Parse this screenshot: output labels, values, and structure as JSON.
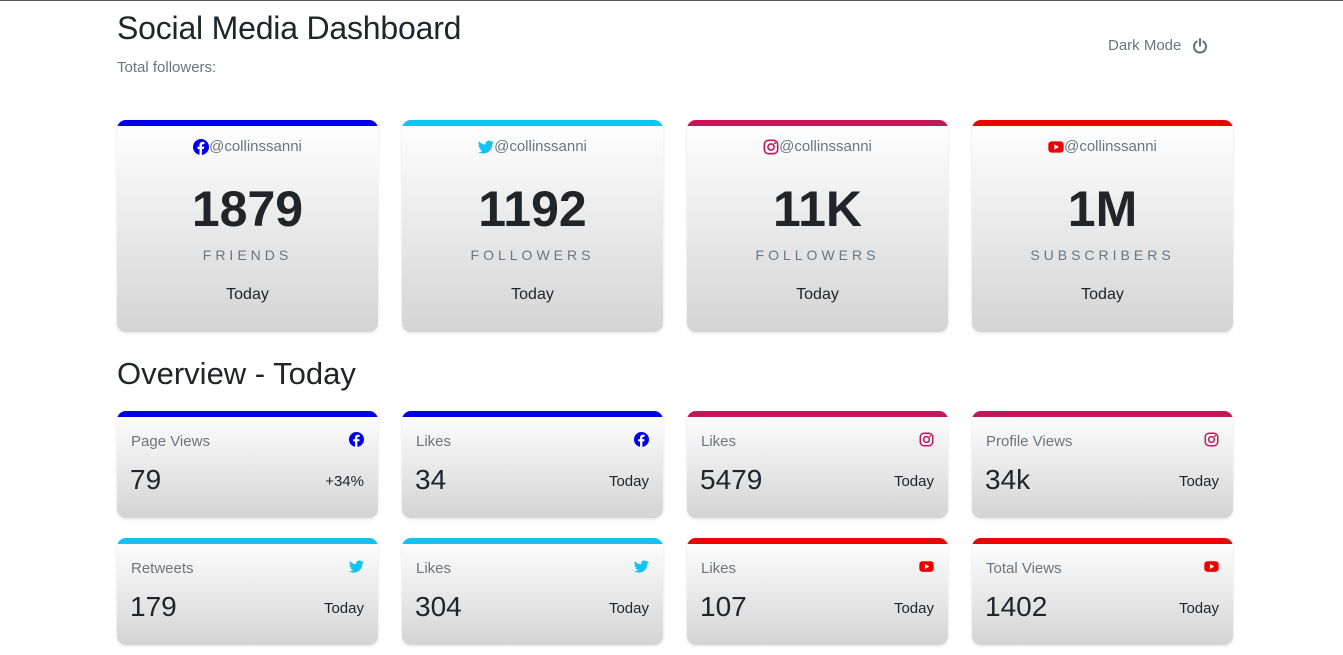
{
  "header": {
    "title": "Social Media Dashboard",
    "total_followers_label": "Total followers:",
    "dark_mode_label": "Dark Mode"
  },
  "colors": {
    "facebook": "#0000e6",
    "twitter": "#12c2f5",
    "instagram": "#c2185b",
    "youtube": "#ee0000"
  },
  "summary_cards": [
    {
      "platform": "facebook",
      "icon": "facebook-icon",
      "handle": "@collinssanni",
      "count": "1879",
      "unit": "FRIENDS",
      "period": "Today"
    },
    {
      "platform": "twitter",
      "icon": "twitter-icon",
      "handle": "@collinssanni",
      "count": "1192",
      "unit": "FOLLOWERS",
      "period": "Today"
    },
    {
      "platform": "instagram",
      "icon": "instagram-icon",
      "handle": "@collinssanni",
      "count": "11K",
      "unit": "FOLLOWERS",
      "period": "Today"
    },
    {
      "platform": "youtube",
      "icon": "youtube-icon",
      "handle": "@collinssanni",
      "count": "1M",
      "unit": "SUBSCRIBERS",
      "period": "Today"
    }
  ],
  "overview": {
    "title": "Overview - Today",
    "cards": [
      {
        "platform": "facebook",
        "icon": "facebook-icon",
        "label": "Page Views",
        "value": "79",
        "meta": "+34%"
      },
      {
        "platform": "facebook",
        "icon": "facebook-icon",
        "label": "Likes",
        "value": "34",
        "meta": "Today"
      },
      {
        "platform": "instagram",
        "icon": "instagram-icon",
        "label": "Likes",
        "value": "5479",
        "meta": "Today"
      },
      {
        "platform": "instagram",
        "icon": "instagram-icon",
        "label": "Profile Views",
        "value": "34k",
        "meta": "Today"
      },
      {
        "platform": "twitter",
        "icon": "twitter-icon",
        "label": "Retweets",
        "value": "179",
        "meta": "Today"
      },
      {
        "platform": "twitter",
        "icon": "twitter-icon",
        "label": "Likes",
        "value": "304",
        "meta": "Today"
      },
      {
        "platform": "youtube",
        "icon": "youtube-icon",
        "label": "Likes",
        "value": "107",
        "meta": "Today"
      },
      {
        "platform": "youtube",
        "icon": "youtube-icon",
        "label": "Total Views",
        "value": "1402",
        "meta": "Today"
      }
    ]
  }
}
